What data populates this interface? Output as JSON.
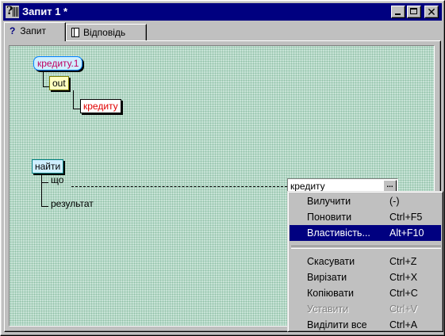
{
  "window": {
    "title": "Запит 1 *"
  },
  "tabs": [
    {
      "label": "Запит",
      "icon": "question-icon",
      "active": true
    },
    {
      "label": "Відповідь",
      "icon": "document-icon",
      "active": false
    }
  ],
  "diagram": {
    "node_top": "кредиту.1",
    "node_out": "out",
    "node_child": "кредиту",
    "node_find": "найти",
    "label_what": "що",
    "label_result": "результат",
    "combo_value": "кредиту",
    "combo_button": "..."
  },
  "context_menu": {
    "items": [
      {
        "label": "Вилучити",
        "shortcut": "(-)",
        "state": "normal"
      },
      {
        "label": "Поновити",
        "shortcut": "Ctrl+F5",
        "state": "normal"
      },
      {
        "label": "Властивість...",
        "shortcut": "Alt+F10",
        "state": "selected"
      },
      {
        "label": "Скасувати",
        "shortcut": "Ctrl+Z",
        "state": "normal"
      },
      {
        "label": "Вирізати",
        "shortcut": "Ctrl+X",
        "state": "normal"
      },
      {
        "label": "Копіювати",
        "shortcut": "Ctrl+C",
        "state": "normal"
      },
      {
        "label": "Уставити",
        "shortcut": "Ctrl+V",
        "state": "disabled"
      },
      {
        "label": "Виділити все",
        "shortcut": "Ctrl+A",
        "state": "normal"
      }
    ]
  },
  "colors": {
    "titlebar": "#000080",
    "canvas": "#c7e3d6",
    "selection": "#000080"
  }
}
